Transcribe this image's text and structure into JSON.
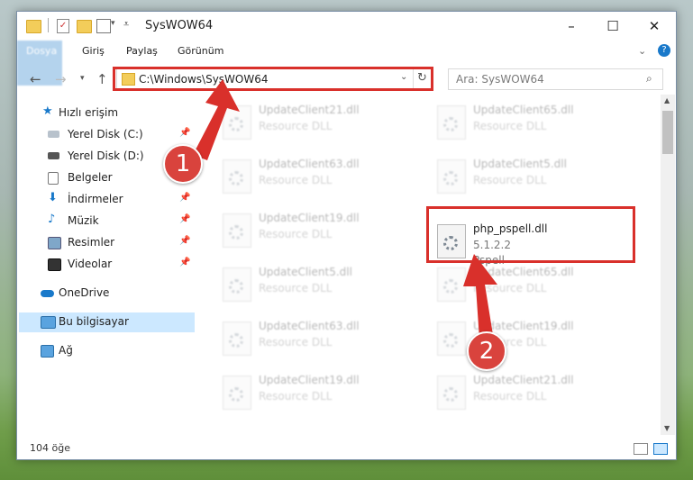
{
  "window": {
    "title": "SysWOW64",
    "minimize": "–",
    "maximize": "☐",
    "close": "✕"
  },
  "ribbon": {
    "tabs": [
      "Dosya",
      "Giriş",
      "Paylaş",
      "Görünüm"
    ]
  },
  "address": {
    "path": "C:\\Windows\\SysWOW64",
    "search_placeholder": "Ara: SysWOW64"
  },
  "sidebar": {
    "items": [
      {
        "label": "Hızlı erişim"
      },
      {
        "label": "Yerel Disk (C:)"
      },
      {
        "label": "Yerel Disk (D:)"
      },
      {
        "label": "Belgeler"
      },
      {
        "label": "İndirmeler"
      },
      {
        "label": "Müzik"
      },
      {
        "label": "Resimler"
      },
      {
        "label": "Videolar"
      },
      {
        "label": "OneDrive"
      },
      {
        "label": "Bu bilgisayar"
      },
      {
        "label": "Ağ"
      }
    ]
  },
  "files": [
    {
      "name": "UpdateClient21.dll",
      "type": "Resource DLL"
    },
    {
      "name": "UpdateClient65.dll",
      "type": "Resource DLL"
    },
    {
      "name": "UpdateClient63.dll",
      "type": "Resource DLL"
    },
    {
      "name": "UpdateClient5.dll",
      "type": "Resource DLL"
    },
    {
      "name": "UpdateClient19.dll",
      "type": "Resource DLL"
    },
    {
      "name": "php_pspell.dll",
      "version": "5.1.2.2",
      "company": "Pspell"
    },
    {
      "name": "UpdateClient5.dll",
      "type": "Resource DLL"
    },
    {
      "name": "UpdateClient65.dll",
      "type": "Resource DLL"
    },
    {
      "name": "UpdateClient63.dll",
      "type": "Resource DLL"
    },
    {
      "name": "UpdateClient19.dll",
      "type": "Resource DLL"
    },
    {
      "name": "UpdateClient19.dll",
      "type": "Resource DLL"
    },
    {
      "name": "UpdateClient21.dll",
      "type": "Resource DLL"
    }
  ],
  "status": {
    "items_count": "104 öğe"
  },
  "annotations": {
    "step1": "1",
    "step2": "2",
    "color": "#d9302b"
  }
}
